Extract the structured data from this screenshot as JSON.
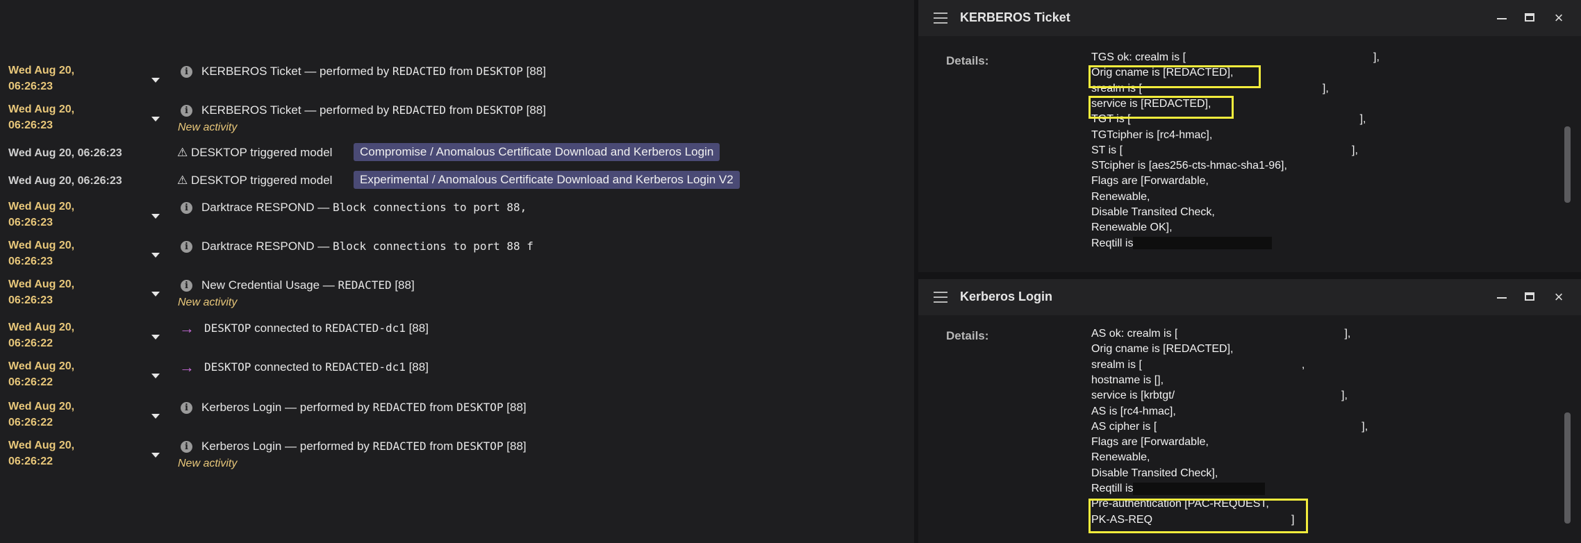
{
  "log": {
    "rows": [
      {
        "ts1": "Wed Aug 20,",
        "ts2": "06:26:23",
        "pre": "KERBEROS Ticket — performed by ",
        "h1": "REDACTED",
        "mid": " from ",
        "h2": "DESKTOP",
        "post": " [88]"
      },
      {
        "ts1": "Wed Aug 20,",
        "ts2": "06:26:23",
        "pre": "KERBEROS Ticket — performed by ",
        "h1": "REDACTED",
        "mid": " from ",
        "h2": "DESKTOP",
        "post": " [88]",
        "sub": "New activity"
      },
      {
        "ts": "Wed Aug 20, 06:26:23",
        "warn": "⚠ DESKTOP  triggered model",
        "pill": "Compromise / Anomalous Certificate Download and Kerberos Login"
      },
      {
        "ts": "Wed Aug 20, 06:26:23",
        "warn": "⚠ DESKTOP  triggered model",
        "pill": "Experimental / Anomalous Certificate Download and Kerberos Login V2"
      },
      {
        "ts1": "Wed Aug 20,",
        "ts2": "06:26:23",
        "pre": "Darktrace RESPOND — ",
        "code": "Block connections to            port 88,"
      },
      {
        "ts1": "Wed Aug 20,",
        "ts2": "06:26:23",
        "pre": "Darktrace RESPOND — ",
        "code": "Block connections to            port 88 f"
      },
      {
        "ts1": "Wed Aug 20,",
        "ts2": "06:26:23",
        "pre": "New Credential Usage — ",
        "h1": "REDACTED",
        "post": " [88]",
        "sub": "New activity"
      },
      {
        "ts1": "Wed Aug 20,",
        "ts2": "06:26:22",
        "h1": "DESKTOP",
        "mid": " connected to ",
        "h2": "REDACTED-dc1",
        "post": " [88]"
      },
      {
        "ts1": "Wed Aug 20,",
        "ts2": "06:26:22",
        "h1": "DESKTOP",
        "mid": " connected to ",
        "h2": "REDACTED-dc1",
        "post": " [88]"
      },
      {
        "ts1": "Wed Aug 20,",
        "ts2": "06:26:22",
        "pre": "Kerberos Login — performed by ",
        "h1": "REDACTED",
        "mid": " from ",
        "h2": "DESKTOP",
        "post": " [88]"
      },
      {
        "ts1": "Wed Aug 20,",
        "ts2": "06:26:22",
        "pre": "Kerberos Login — performed by ",
        "h1": "REDACTED",
        "mid": " from ",
        "h2": "DESKTOP",
        "post": " [88]",
        "sub": "New activity"
      }
    ]
  },
  "ticket_panel": {
    "title": "KERBEROS Ticket",
    "details_label": "Details:",
    "lines": [
      "TGS ok: crealm is [",
      "Orig cname is [REDACTED],",
      "srealm is [",
      "service is [REDACTED],",
      "TGT is [",
      "TGTcipher is [rc4-hmac],",
      "ST is [",
      "STcipher is [aes256-cts-hmac-sha1-96],",
      "Flags are [Forwardable,",
      "Renewable,",
      "Disable Transited Check,",
      "Renewable OK],",
      "Reqtill is"
    ]
  },
  "login_panel": {
    "title": "Kerberos Login",
    "details_label": "Details:",
    "lines": [
      "AS ok: crealm is [",
      "Orig cname is [REDACTED],",
      "srealm is [",
      "hostname is [],",
      "service is [krbtgt/",
      "AS is [rc4-hmac],",
      "AS cipher is [",
      "Flags are [Forwardable,",
      "Renewable,",
      "Disable Transited Check],",
      "Reqtill is",
      "Pre-authentication [PAC-REQUEST,",
      "PK-AS-REQ"
    ]
  },
  "window_controls": {
    "minimize": "minimize",
    "maximize": "maximize",
    "close": "×"
  },
  "colors": {
    "accent_yellow": "#f2ec3c",
    "timestamp": "#e8c77a",
    "pill": "#4a4a75",
    "arrow": "#c76bd8"
  }
}
